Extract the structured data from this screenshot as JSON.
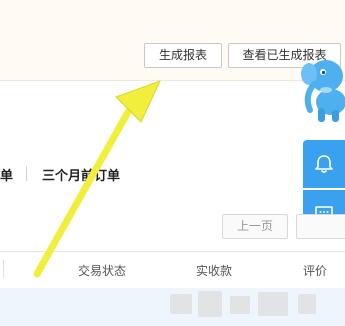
{
  "report_actions": {
    "generate_label": "生成报表",
    "view_generated_label": "查看已生成报表"
  },
  "order_tabs": {
    "partial_tab_label": "单",
    "three_months_label": "三个月前订单"
  },
  "pagination": {
    "prev_label": "上一页"
  },
  "order_table": {
    "columns": [
      "交易状态",
      "实收款",
      "评价"
    ]
  },
  "colors": {
    "sidebar_blue": "#3aa0f0",
    "arrow_yellow": "#f2ee3c",
    "top_panel_bg": "#fffaf3"
  },
  "icons": [
    "bell-icon",
    "message-icon",
    "elephant-mascot-icon",
    "annotation-arrow"
  ]
}
